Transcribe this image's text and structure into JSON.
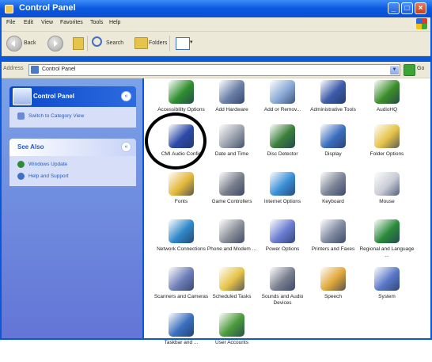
{
  "window": {
    "title": "Control Panel"
  },
  "menu": [
    "File",
    "Edit",
    "View",
    "Favorites",
    "Tools",
    "Help"
  ],
  "toolbar": {
    "back_label": "Back",
    "search_label": "Search",
    "folders_label": "Folders"
  },
  "address": {
    "label": "Address",
    "value": "Control Panel",
    "go_label": "Go"
  },
  "left_pane": {
    "control_panel": {
      "title": "Control Panel",
      "link": "Switch to Category View"
    },
    "see_also": {
      "title": "See Also",
      "links": [
        "Windows Update",
        "Help and Support"
      ]
    }
  },
  "items": [
    {
      "label": "Accessibility Options",
      "icon": "accessibility-icon",
      "color": "#2f8f2f"
    },
    {
      "label": "Add Hardware",
      "icon": "add-hardware-icon",
      "color": "#6b7fa8"
    },
    {
      "label": "Add or Remov...",
      "icon": "add-remove-programs-icon",
      "color": "#8aa9d6"
    },
    {
      "label": "Administrative Tools",
      "icon": "admin-tools-icon",
      "color": "#3b5aa8"
    },
    {
      "label": "AudioHQ",
      "icon": "audiohq-icon",
      "color": "#3b8e2a"
    },
    {
      "label": "CMI Audio Config",
      "icon": "cmi-audio-icon",
      "color": "#2c4aa8"
    },
    {
      "label": "Date and Time",
      "icon": "date-time-icon",
      "color": "#9aa0ad"
    },
    {
      "label": "Disc Detector",
      "icon": "disc-detector-icon",
      "color": "#3a7f3a"
    },
    {
      "label": "Display",
      "icon": "display-icon",
      "color": "#3c6fbf"
    },
    {
      "label": "Folder Options",
      "icon": "folder-options-icon",
      "color": "#e6c34a"
    },
    {
      "label": "Fonts",
      "icon": "fonts-icon",
      "color": "#e3b83a"
    },
    {
      "label": "Game Controllers",
      "icon": "game-controllers-icon",
      "color": "#7a7f8c"
    },
    {
      "label": "Internet Options",
      "icon": "internet-options-icon",
      "color": "#3a8fd6"
    },
    {
      "label": "Keyboard",
      "icon": "keyboard-icon",
      "color": "#7c8596"
    },
    {
      "label": "Mouse",
      "icon": "mouse-icon",
      "color": "#c9ccd6"
    },
    {
      "label": "Network Connections",
      "icon": "network-icon",
      "color": "#2f88c8"
    },
    {
      "label": "Phone and Modem ...",
      "icon": "phone-modem-icon",
      "color": "#8a8f99"
    },
    {
      "label": "Power Options",
      "icon": "power-options-icon",
      "color": "#6a7bd0"
    },
    {
      "label": "Printers and Faxes",
      "icon": "printers-icon",
      "color": "#7f8aa0"
    },
    {
      "label": "Regional and Language ...",
      "icon": "regional-icon",
      "color": "#2a8a3a"
    },
    {
      "label": "Scanners and Cameras",
      "icon": "scanners-icon",
      "color": "#6f7fb8"
    },
    {
      "label": "Scheduled Tasks",
      "icon": "scheduled-tasks-icon",
      "color": "#e6c34a"
    },
    {
      "label": "Sounds and Audio Devices",
      "icon": "sounds-icon",
      "color": "#7a8090"
    },
    {
      "label": "Speech",
      "icon": "speech-icon",
      "color": "#e0a83a"
    },
    {
      "label": "System",
      "icon": "system-icon",
      "color": "#5a78c8"
    },
    {
      "label": "Taskbar and ...",
      "icon": "taskbar-icon",
      "color": "#3a6fbf"
    },
    {
      "label": "User Accounts",
      "icon": "user-accounts-icon",
      "color": "#4a9a3a"
    }
  ],
  "colors": {
    "titlebar": "#0b58e0",
    "task_pane": "#7ba2e7",
    "highlight_ring": "#000000"
  }
}
